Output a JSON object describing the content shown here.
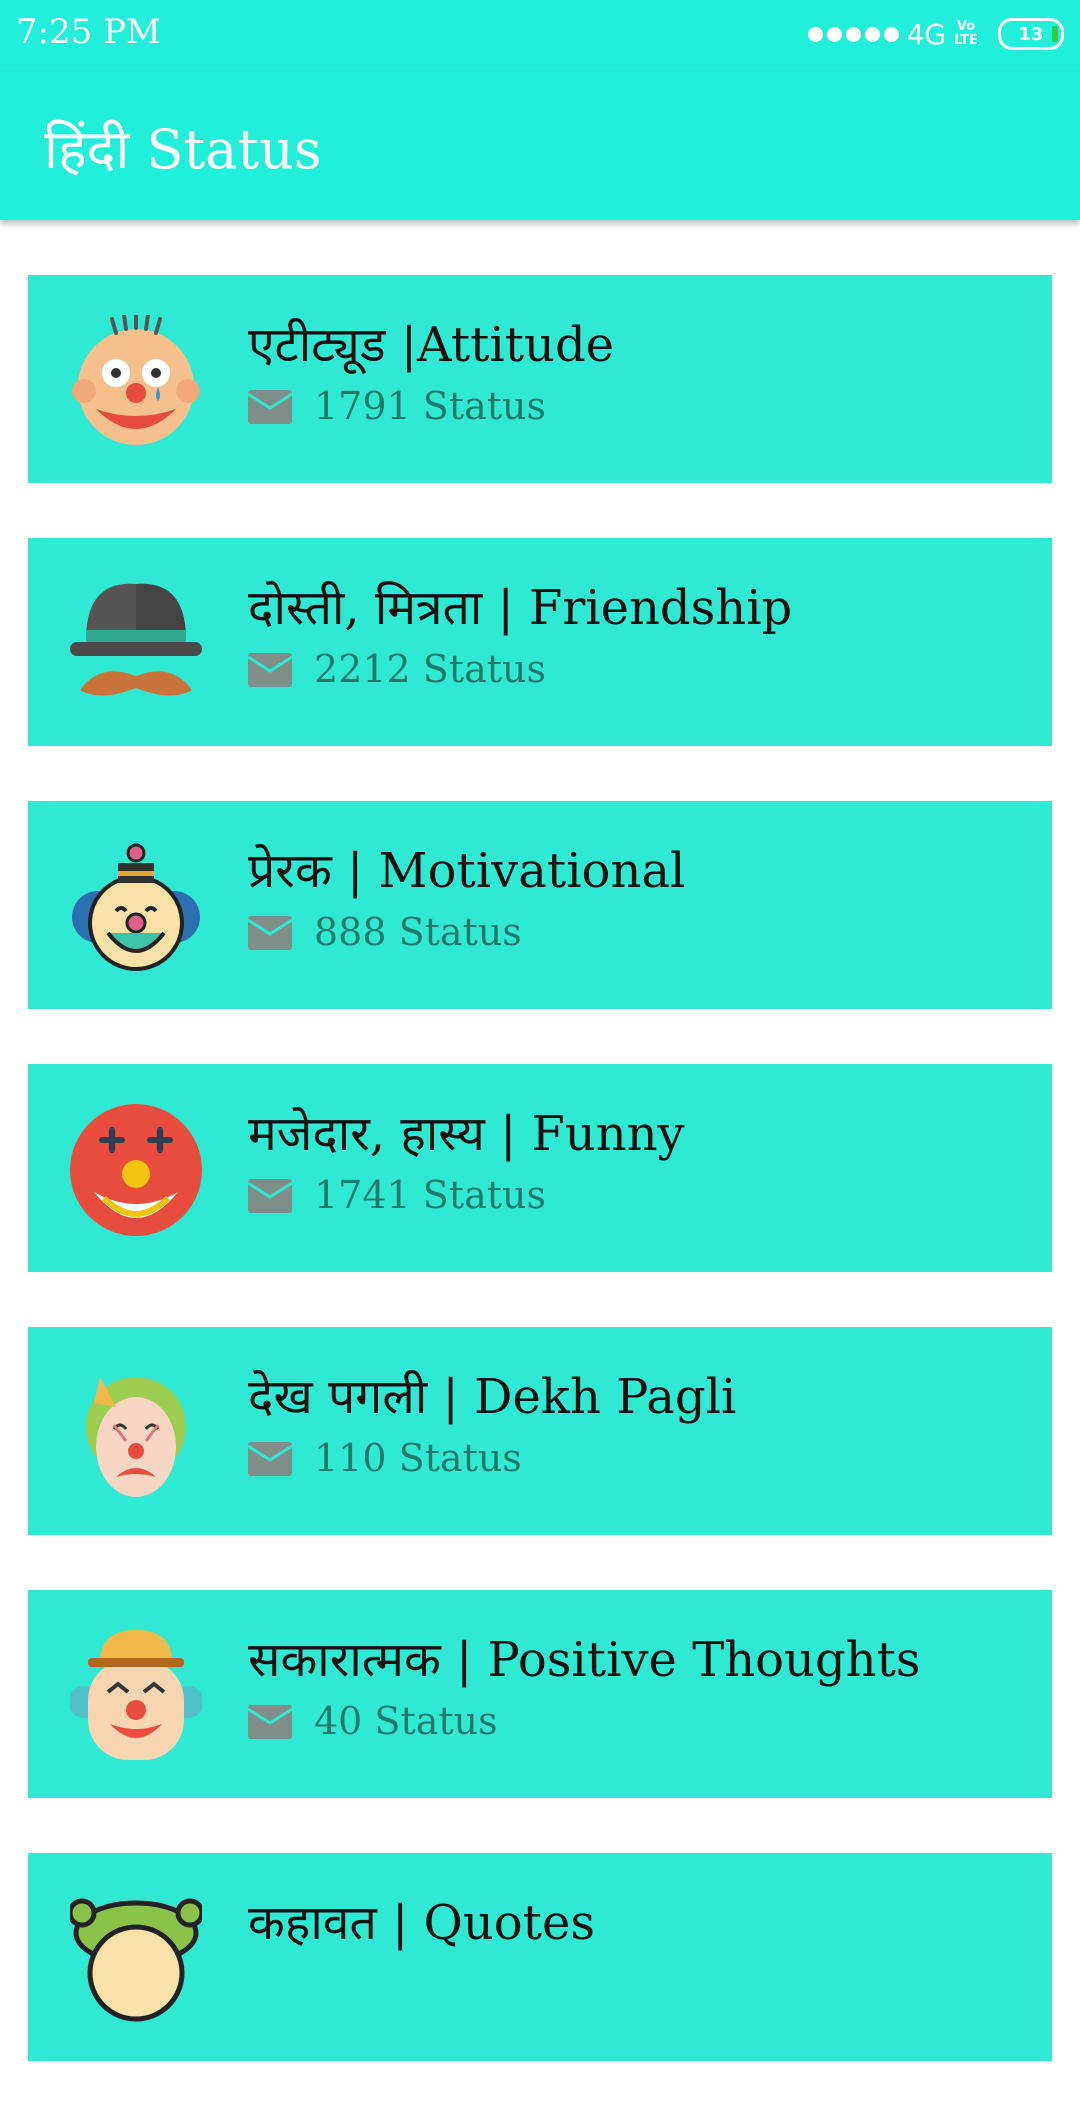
{
  "status_bar": {
    "time": "7:25 PM",
    "network": "4G",
    "volte": [
      "Vo",
      "LTE"
    ],
    "battery": "13"
  },
  "app_bar": {
    "title": "हिंदी Status"
  },
  "colors": {
    "primary": "#22efd9",
    "card": "#2fe9d2",
    "count_text": "#1f7a6b"
  },
  "categories": [
    {
      "title": "एटीट्यूड |Attitude",
      "count": "1791 Status",
      "icon": "clown-face-blue-hair-icon"
    },
    {
      "title": "दोस्ती, मित्रता  | Friendship",
      "count": "2212 Status",
      "icon": "hat-mustache-icon"
    },
    {
      "title": "प्रेरक | Motivational",
      "count": "888 Status",
      "icon": "clown-hat-icon"
    },
    {
      "title": "मजेदार, हास्य | Funny",
      "count": "1741 Status",
      "icon": "red-clown-face-icon"
    },
    {
      "title": "देख पगली | Dekh Pagli",
      "count": "110 Status",
      "icon": "sad-clown-icon"
    },
    {
      "title": "सकारात्मक | Positive Thoughts",
      "count": "40 Status",
      "icon": "smiling-clown-hat-icon"
    },
    {
      "title": "कहावत | Quotes",
      "count": "",
      "icon": "green-hair-clown-icon"
    }
  ]
}
